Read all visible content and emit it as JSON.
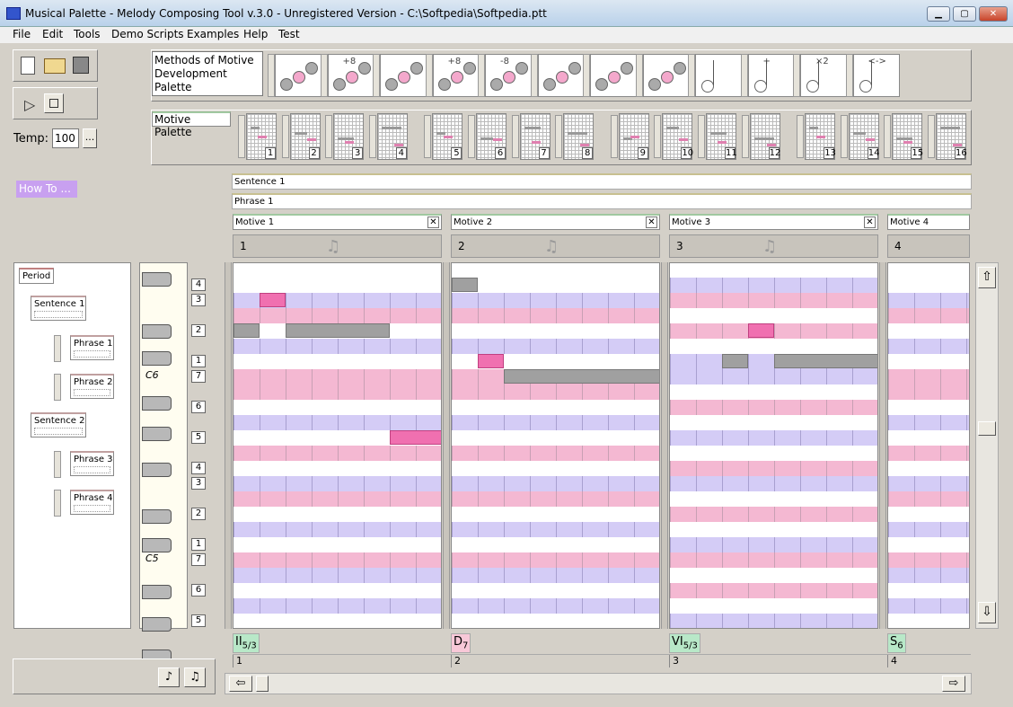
{
  "window": {
    "title": "Musical Palette - Melody Composing Tool v.3.0 - Unregistered Version - C:\\Softpedia\\Softpedia.ptt"
  },
  "menu": [
    "File",
    "Edit",
    "Tools",
    "Demo Scripts",
    "Examples",
    "Help",
    "Test"
  ],
  "toolbar": {
    "tempo_label": "Temp:",
    "tempo_value": "100",
    "tempo_more": "...",
    "howto": "How To ..."
  },
  "methods": {
    "title": "Methods of Motive Development Palette",
    "annotations": [
      "",
      "+8",
      "",
      "+8",
      "-8",
      "",
      "",
      "",
      "",
      "+",
      "×2",
      "<->"
    ]
  },
  "motive_palette": {
    "title": "Motive Palette",
    "numbers": [
      "1",
      "2",
      "3",
      "4",
      "5",
      "6",
      "7",
      "8",
      "9",
      "10",
      "11",
      "12",
      "13",
      "14",
      "15",
      "16"
    ]
  },
  "structure": {
    "sentence": "Sentence 1",
    "phrase": "Phrase 1",
    "motives": [
      {
        "label": "Motive 1",
        "num": "1"
      },
      {
        "label": "Motive 2",
        "num": "2"
      },
      {
        "label": "Motive 3",
        "num": "3"
      },
      {
        "label": "Motive 4",
        "num": "4"
      }
    ]
  },
  "tree": {
    "period": "Period",
    "s1": "Sentence 1",
    "p1": "Phrase 1",
    "p2": "Phrase 2",
    "s2": "Sentence 2",
    "p3": "Phrase 3",
    "p4": "Phrase 4"
  },
  "piano": {
    "numbers": [
      "4",
      "3",
      "2",
      "1",
      "7",
      "6",
      "5",
      "4",
      "3",
      "2",
      "1",
      "7",
      "6",
      "5"
    ],
    "c6": "C6",
    "c5": "C5"
  },
  "chords": [
    {
      "main": "II",
      "sub": "5/3",
      "color": "#b8e8c8"
    },
    {
      "main": "D",
      "sub": "7",
      "color": "#f8c8d8"
    },
    {
      "main": "VI",
      "sub": "5/3",
      "color": "#b8e8c8"
    },
    {
      "main": "S",
      "sub": "6",
      "color": "#b8e8c8"
    }
  ],
  "bars": [
    "1",
    "2",
    "3",
    "4"
  ],
  "colors": {
    "pink_row": "#f4b8d2",
    "violet_row": "#d4ccf6",
    "note_pink": "#f070b0",
    "note_gray": "#a0a0a0",
    "howto_bg": "#c8a0f0"
  }
}
